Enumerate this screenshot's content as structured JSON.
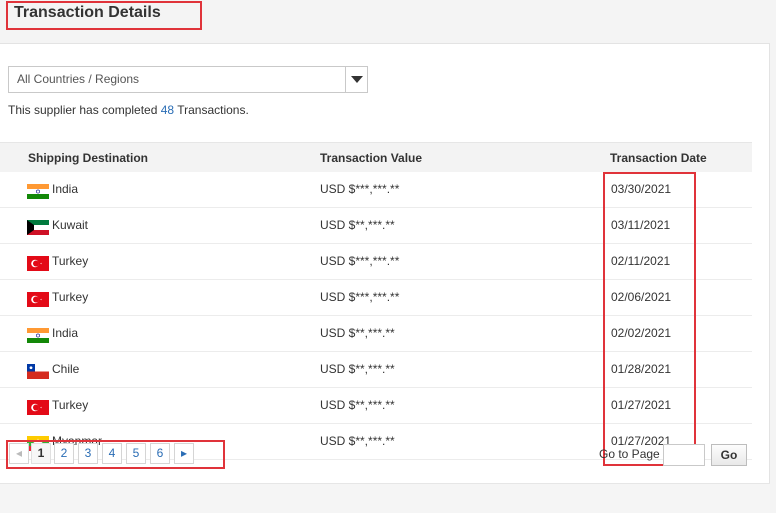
{
  "header": {
    "title": "Transaction Details"
  },
  "filter": {
    "selected": "All Countries / Regions"
  },
  "summary": {
    "prefix": "This supplier has completed ",
    "count": "48",
    "suffix": " Transactions."
  },
  "table": {
    "columns": [
      "Shipping Destination",
      "Transaction Value",
      "Transaction Date"
    ],
    "rows": [
      {
        "destination": "India",
        "flag": "india-flag-icon",
        "value": "USD $***,***.**",
        "date": "03/30/2021"
      },
      {
        "destination": "Kuwait",
        "flag": "kuwait-flag-icon",
        "value": "USD $**,***.**",
        "date": "03/11/2021"
      },
      {
        "destination": "Turkey",
        "flag": "turkey-flag-icon",
        "value": "USD $***,***.**",
        "date": "02/11/2021"
      },
      {
        "destination": "Turkey",
        "flag": "turkey-flag-icon",
        "value": "USD $***,***.**",
        "date": "02/06/2021"
      },
      {
        "destination": "India",
        "flag": "india-flag-icon",
        "value": "USD $**,***.**",
        "date": "02/02/2021"
      },
      {
        "destination": "Chile",
        "flag": "chile-flag-icon",
        "value": "USD $**,***.**",
        "date": "01/28/2021"
      },
      {
        "destination": "Turkey",
        "flag": "turkey-flag-icon",
        "value": "USD $**,***.**",
        "date": "01/27/2021"
      },
      {
        "destination": "Myanmar",
        "flag": "myanmar-flag-icon",
        "value": "USD $**,***.**",
        "date": "01/27/2021"
      }
    ]
  },
  "pagination": {
    "prev_icon": "chevron-left-icon",
    "next_icon": "chevron-right-icon",
    "pages": [
      "1",
      "2",
      "3",
      "4",
      "5",
      "6"
    ],
    "current": "1",
    "prev_label": "◂",
    "next_label": "▸",
    "goto_label": "Go to Page",
    "goto_value": "",
    "go_button": "Go"
  },
  "colors": {
    "highlight": "#e0333a",
    "link": "#2a6db5"
  }
}
